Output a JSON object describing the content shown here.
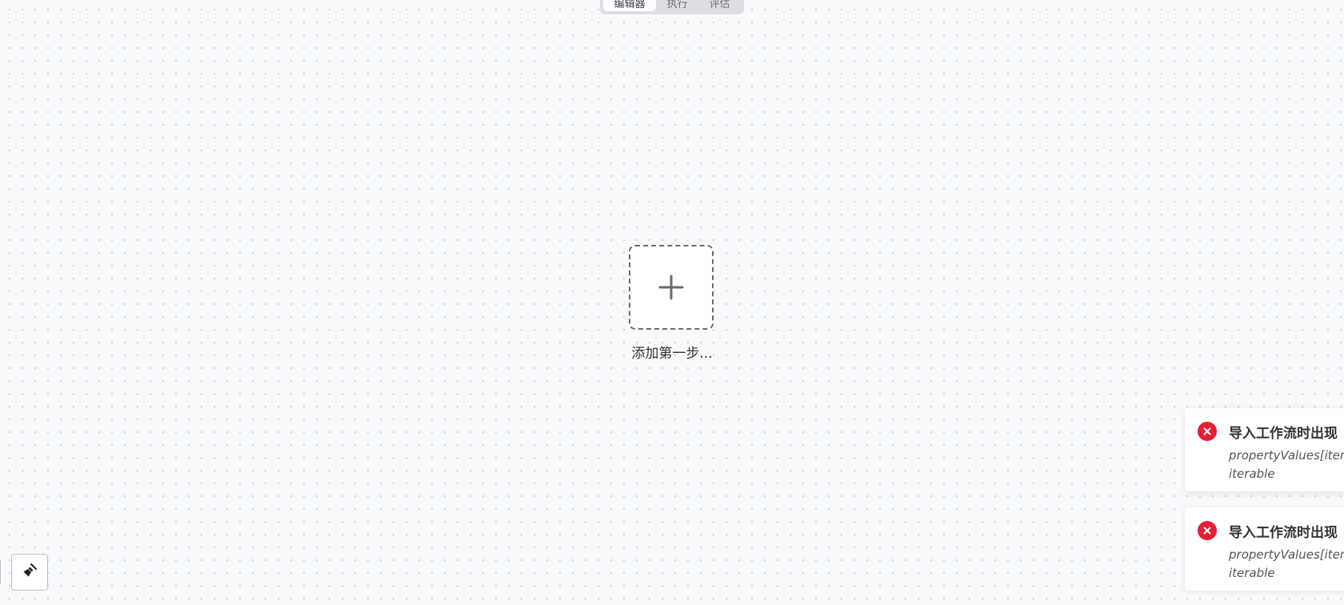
{
  "tabs": [
    {
      "label": "编辑器",
      "active": true
    },
    {
      "label": "执行",
      "active": false
    },
    {
      "label": "评估",
      "active": false
    }
  ],
  "canvas": {
    "add_step": {
      "icon": "plus-icon",
      "label": "添加第一步..."
    }
  },
  "controls": {
    "clean_icon": "broom-icon"
  },
  "toasts": [
    {
      "icon": "error-icon",
      "title": "导入工作流时出现",
      "message": "propertyValues[item\niterable"
    },
    {
      "icon": "error-icon",
      "title": "导入工作流时出现",
      "message": "propertyValues[item\niterable"
    }
  ],
  "colors": {
    "error": "#e81d34",
    "canvas_background": "#f8fafc"
  }
}
